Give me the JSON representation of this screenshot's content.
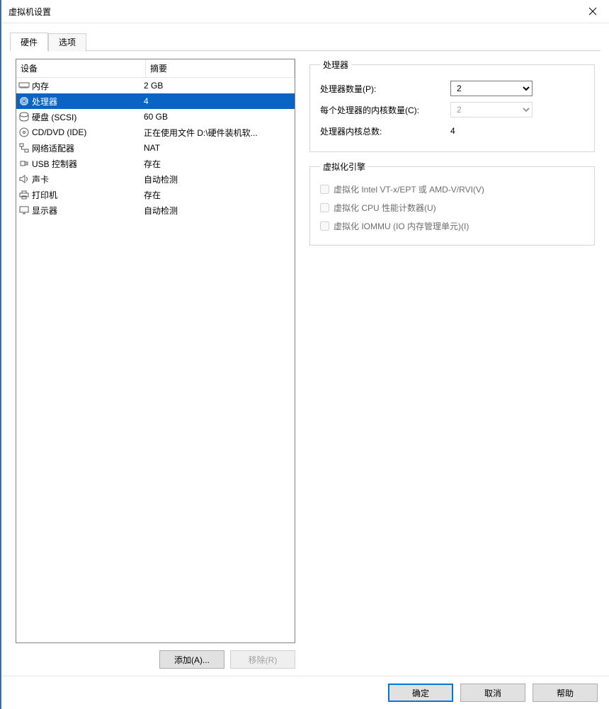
{
  "window": {
    "title": "虚拟机设置"
  },
  "tabs": {
    "hardware": "硬件",
    "options": "选项"
  },
  "columns": {
    "device": "设备",
    "summary": "摘要"
  },
  "hardware": [
    {
      "icon": "memory",
      "name": "内存",
      "summary": "2 GB",
      "selected": false
    },
    {
      "icon": "cpu",
      "name": "处理器",
      "summary": "4",
      "selected": true
    },
    {
      "icon": "disk",
      "name": "硬盘 (SCSI)",
      "summary": "60 GB",
      "selected": false
    },
    {
      "icon": "cd",
      "name": "CD/DVD (IDE)",
      "summary": "正在使用文件 D:\\硬件装机软...",
      "selected": false
    },
    {
      "icon": "network",
      "name": "网络适配器",
      "summary": "NAT",
      "selected": false
    },
    {
      "icon": "usb",
      "name": "USB 控制器",
      "summary": "存在",
      "selected": false
    },
    {
      "icon": "sound",
      "name": "声卡",
      "summary": "自动检测",
      "selected": false
    },
    {
      "icon": "printer",
      "name": "打印机",
      "summary": "存在",
      "selected": false
    },
    {
      "icon": "display",
      "name": "显示器",
      "summary": "自动检测",
      "selected": false
    }
  ],
  "left_buttons": {
    "add": "添加(A)...",
    "remove": "移除(R)"
  },
  "processors": {
    "legend": "处理器",
    "count_label": "处理器数量(P):",
    "count_value": "2",
    "cores_label": "每个处理器的内核数量(C):",
    "cores_value": "2",
    "total_label": "处理器内核总数:",
    "total_value": "4"
  },
  "virt": {
    "legend": "虚拟化引擎",
    "vt_label": "虚拟化 Intel VT-x/EPT 或 AMD-V/RVI(V)",
    "counters_label": "虚拟化 CPU 性能计数器(U)",
    "iommu_label": "虚拟化 IOMMU (IO 内存管理单元)(I)"
  },
  "bottom": {
    "ok": "确定",
    "cancel": "取消",
    "help": "帮助"
  }
}
